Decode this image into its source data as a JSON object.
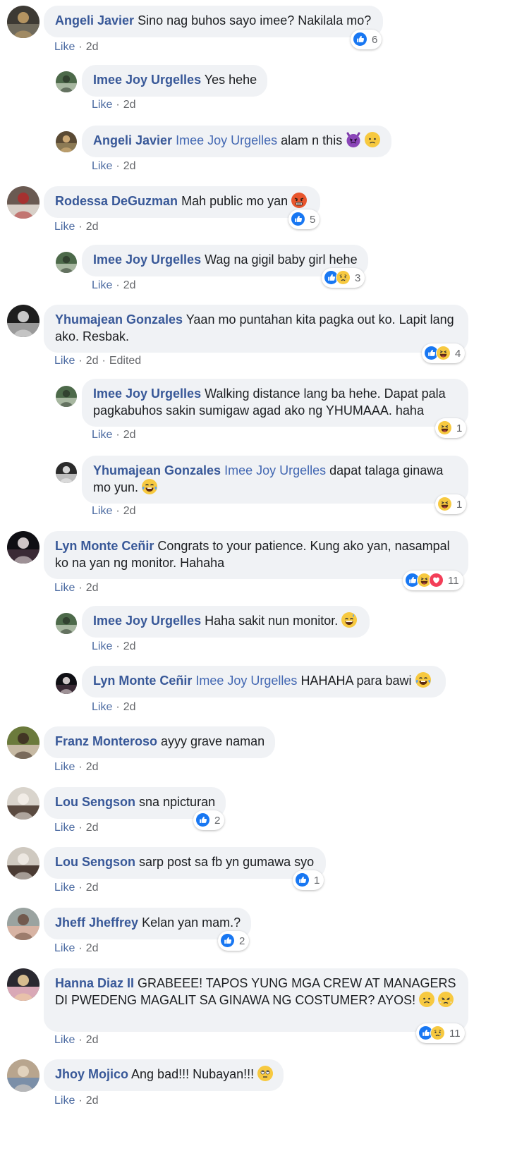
{
  "ui": {
    "like_label": "Like",
    "separator": "·",
    "edited_label": "Edited"
  },
  "comments": [
    {
      "author": "Angeli Javier",
      "text": "Sino nag buhos sayo imee? Nakilala mo?",
      "time": "2d",
      "reactions": {
        "icons": [
          "like-icon"
        ],
        "count": "6"
      }
    },
    {
      "author": "Imee Joy Urgelles",
      "text": "Yes hehe",
      "time": "2d"
    },
    {
      "author": "Angeli Javier",
      "mention": "Imee Joy Urgelles",
      "text": "alam n this",
      "emojis": [
        "devil-emoji",
        "frown-emoji"
      ],
      "time": "2d"
    },
    {
      "author": "Rodessa DeGuzman",
      "text": "Mah public mo yan",
      "emojis": [
        "angry-emoji"
      ],
      "time": "2d",
      "reactions": {
        "icons": [
          "like-icon"
        ],
        "count": "5"
      }
    },
    {
      "author": "Imee Joy Urgelles",
      "text": "Wag na gigil baby girl hehe",
      "time": "2d",
      "reactions": {
        "icons": [
          "like-icon",
          "sad-icon"
        ],
        "count": "3"
      }
    },
    {
      "author": "Yhumajean Gonzales",
      "text": "Yaan mo puntahan kita pagka out ko. Lapit lang ako. Resbak.",
      "time": "2d",
      "edited": true,
      "reactions": {
        "icons": [
          "like-icon",
          "haha-icon"
        ],
        "count": "4"
      }
    },
    {
      "author": "Imee Joy Urgelles",
      "text": "Walking distance lang ba hehe. Dapat pala pagkabuhos sakin sumigaw agad ako ng YHUMAAA. haha",
      "time": "2d",
      "reactions": {
        "icons": [
          "haha-icon"
        ],
        "count": "1"
      }
    },
    {
      "author": "Yhumajean Gonzales",
      "mention": "Imee Joy Urgelles",
      "text": "dapat talaga ginawa mo yun.",
      "emojis": [
        "tears-of-joy-emoji"
      ],
      "time": "2d",
      "reactions": {
        "icons": [
          "haha-icon"
        ],
        "count": "1"
      }
    },
    {
      "author": "Lyn Monte Ceñir",
      "text": "Congrats to your patience. Kung ako yan, nasampal ko na yan ng monitor. Hahaha",
      "time": "2d",
      "reactions": {
        "icons": [
          "like-icon",
          "haha-icon",
          "love-icon"
        ],
        "count": "11"
      }
    },
    {
      "author": "Imee Joy Urgelles",
      "text": "Haha sakit nun monitor.",
      "emojis": [
        "sweat-smile-emoji"
      ],
      "time": "2d"
    },
    {
      "author": "Lyn Monte Ceñir",
      "mention": "Imee Joy Urgelles",
      "text": "HAHAHA para bawi",
      "emojis": [
        "tears-of-joy-emoji"
      ],
      "time": "2d"
    },
    {
      "author": "Franz Monteroso",
      "text": "ayyy grave naman",
      "time": "2d"
    },
    {
      "author": "Lou Sengson",
      "text": "sna npicturan",
      "time": "2d",
      "reactions": {
        "icons": [
          "like-icon"
        ],
        "count": "2"
      }
    },
    {
      "author": "Lou Sengson",
      "text": "sarp post sa fb yn gumawa syo",
      "time": "2d",
      "reactions": {
        "icons": [
          "like-icon"
        ],
        "count": "1"
      }
    },
    {
      "author": "Jheff Jheffrey",
      "text": "Kelan yan mam.?",
      "time": "2d",
      "reactions": {
        "icons": [
          "like-icon"
        ],
        "count": "2"
      }
    },
    {
      "author": "Hanna Diaz II",
      "text": "GRABEEE! TAPOS YUNG MGA CREW AT MANAGERS DI PWEDENG MAGALIT SA GINAWA NG COSTUMER? AYOS!",
      "emojis": [
        "frown-emoji",
        "triumph-emoji"
      ],
      "time": "2d",
      "reactions": {
        "icons": [
          "like-icon",
          "sad-icon"
        ],
        "count": "11"
      }
    },
    {
      "author": "Jhoy Mojico",
      "text": "Ang bad!!! Nubayan!!!",
      "emojis": [
        "eye-roll-emoji"
      ],
      "time": "2d"
    }
  ],
  "colors": {
    "author": "#385898",
    "mention": "#4267b2",
    "bubble": "#f0f2f5",
    "meta": "#65676b",
    "like_blue": "#1877f2",
    "love_red": "#f33e58",
    "emoji_yellow": "#f7c940"
  }
}
